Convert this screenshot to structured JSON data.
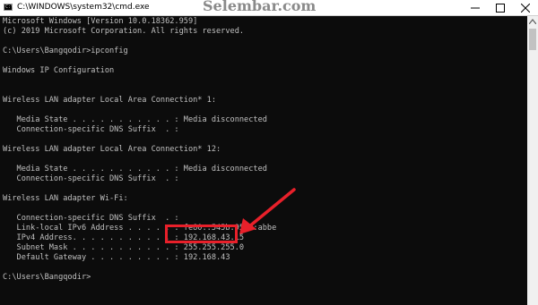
{
  "window": {
    "title": "C:\\WINDOWS\\system32\\cmd.exe",
    "icon": "cmd-icon",
    "icon_glyph": "C:\\",
    "watermark": "Selembar.com"
  },
  "controls": {
    "minimize": "minimize-icon",
    "maximize": "maximize-icon",
    "close": "close-icon"
  },
  "console": {
    "lines": [
      "Microsoft Windows [Version 10.0.18362.959]",
      "(c) 2019 Microsoft Corporation. All rights reserved.",
      "",
      "C:\\Users\\Bangqodir>ipconfig",
      "",
      "Windows IP Configuration",
      "",
      "",
      "Wireless LAN adapter Local Area Connection* 1:",
      "",
      "   Media State . . . . . . . . . . . : Media disconnected",
      "   Connection-specific DNS Suffix  . :",
      "",
      "Wireless LAN adapter Local Area Connection* 12:",
      "",
      "   Media State . . . . . . . . . . . : Media disconnected",
      "   Connection-specific DNS Suffix  . :",
      "",
      "Wireless LAN adapter Wi-Fi:",
      "",
      "   Connection-specific DNS Suffix  . :",
      "   Link-local IPv6 Address . . . . . : fe80::545b:95e0:abbe",
      "   IPv4 Address. . . . . . . . . . . : 192.168.43.15",
      "   Subnet Mask . . . . . . . . . . . : 255.255.255.0",
      "   Default Gateway . . . . . . . . . : 192.168.43",
      "",
      "C:\\Users\\Bangqodir>"
    ]
  },
  "annotation": {
    "highlight_color": "#e8202a",
    "target": "IPv4 Address"
  }
}
